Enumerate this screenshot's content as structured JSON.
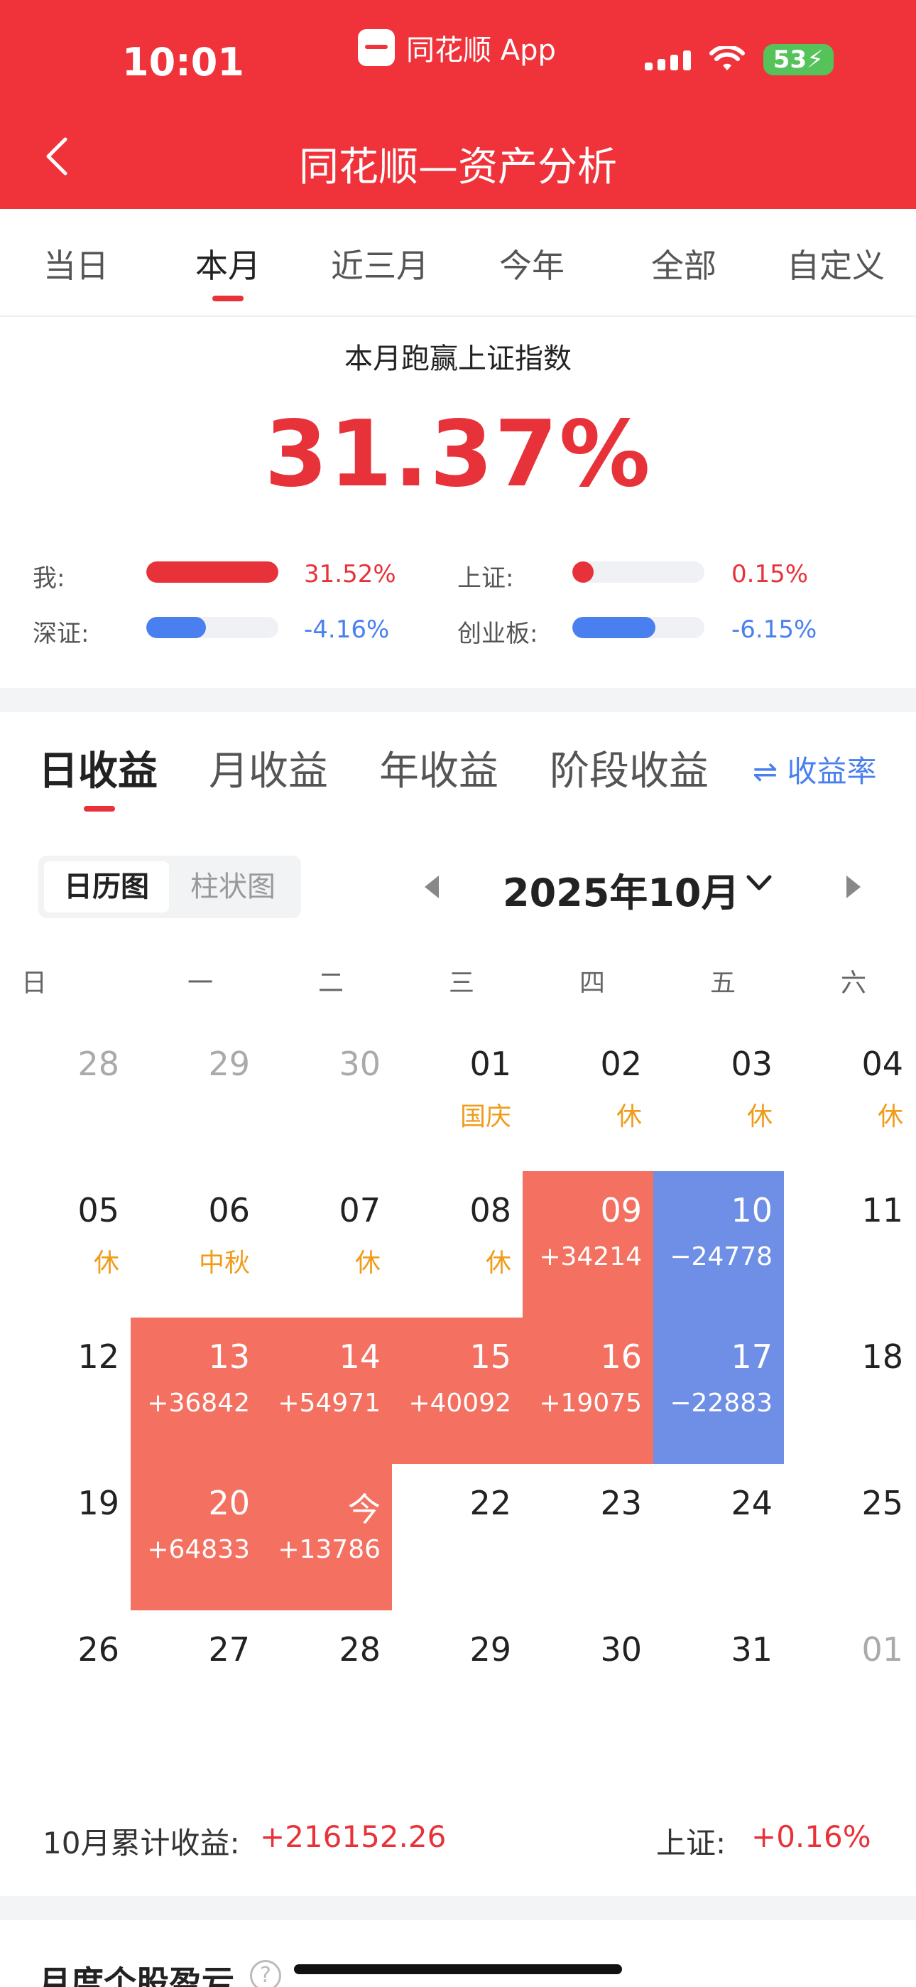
{
  "status": {
    "time": "10:01",
    "app_name": "同花顺 App",
    "battery": "53"
  },
  "nav": {
    "title": "同花顺—资产分析"
  },
  "period_tabs": [
    {
      "label": "当日"
    },
    {
      "label": "本月"
    },
    {
      "label": "近三月"
    },
    {
      "label": "今年"
    },
    {
      "label": "全部"
    },
    {
      "label": "自定义"
    }
  ],
  "active_period": "本月",
  "performance": {
    "title": "本月跑赢上证指数",
    "value": "31.37%",
    "comparisons": [
      {
        "label": "我:",
        "value": "31.52%",
        "level": 1.0,
        "color": "#e8323a"
      },
      {
        "label": "上证:",
        "value": "0.15%",
        "level": 0.08,
        "color": "#e8323a"
      },
      {
        "label": "深证:",
        "value": "-4.16%",
        "level": 0.45,
        "color": "#4a7ff0"
      },
      {
        "label": "创业板:",
        "value": "-6.15%",
        "level": 0.63,
        "color": "#4a7ff0"
      }
    ]
  },
  "earnings_tabs": [
    {
      "label": "日收益"
    },
    {
      "label": "月收益"
    },
    {
      "label": "年收益"
    },
    {
      "label": "阶段收益"
    }
  ],
  "rate_toggle": "⇌ 收益率",
  "view_toggle": {
    "calendar": "日历图",
    "bar": "柱状图"
  },
  "month_label": "2025年10月",
  "weekdays": [
    "日",
    "一",
    "二",
    "三",
    "四",
    "五",
    "六"
  ],
  "calendar": [
    [
      {
        "d": "28",
        "muted": true
      },
      {
        "d": "29",
        "muted": true
      },
      {
        "d": "30",
        "muted": true
      },
      {
        "d": "01",
        "sub": "国庆",
        "kind": "holiday"
      },
      {
        "d": "02",
        "sub": "休",
        "kind": "holiday"
      },
      {
        "d": "03",
        "sub": "休",
        "kind": "holiday"
      },
      {
        "d": "04",
        "sub": "休",
        "kind": "holiday"
      }
    ],
    [
      {
        "d": "05",
        "sub": "休",
        "kind": "holiday"
      },
      {
        "d": "06",
        "sub": "中秋",
        "kind": "holiday"
      },
      {
        "d": "07",
        "sub": "休",
        "kind": "holiday"
      },
      {
        "d": "08",
        "sub": "休",
        "kind": "holiday"
      },
      {
        "d": "09",
        "sub": "+34214",
        "kind": "gain"
      },
      {
        "d": "10",
        "sub": "−24778",
        "kind": "loss"
      },
      {
        "d": "11"
      }
    ],
    [
      {
        "d": "12"
      },
      {
        "d": "13",
        "sub": "+36842",
        "kind": "gain"
      },
      {
        "d": "14",
        "sub": "+54971",
        "kind": "gain"
      },
      {
        "d": "15",
        "sub": "+40092",
        "kind": "gain"
      },
      {
        "d": "16",
        "sub": "+19075",
        "kind": "gain"
      },
      {
        "d": "17",
        "sub": "−22883",
        "kind": "loss"
      },
      {
        "d": "18"
      }
    ],
    [
      {
        "d": "19"
      },
      {
        "d": "20",
        "sub": "+64833",
        "kind": "gain"
      },
      {
        "d": "今",
        "sub": "+13786",
        "kind": "gain"
      },
      {
        "d": "22"
      },
      {
        "d": "23"
      },
      {
        "d": "24"
      },
      {
        "d": "25"
      }
    ],
    [
      {
        "d": "26"
      },
      {
        "d": "27"
      },
      {
        "d": "28"
      },
      {
        "d": "29"
      },
      {
        "d": "30"
      },
      {
        "d": "31"
      },
      {
        "d": "01",
        "muted": true
      }
    ]
  ],
  "summary": {
    "month_label": "10月累计收益:",
    "month_value": "+216152.26",
    "index_label": "上证:",
    "index_value": "+0.16%"
  },
  "bottom_section": {
    "title": "月度个股盈亏",
    "help": "?"
  }
}
